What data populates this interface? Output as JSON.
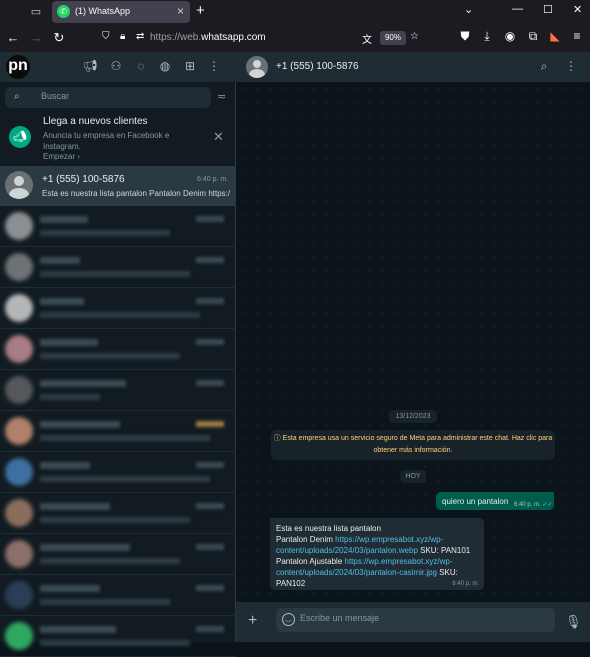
{
  "browser": {
    "tab_title": "(1) WhatsApp",
    "url_host": "https://web.",
    "url_domain": "whatsapp.com",
    "zoom": "90%"
  },
  "sidebar": {
    "logo": "pn",
    "search_placeholder": "Buscar",
    "promo": {
      "title": "Llega a nuevos clientes",
      "text": "Anuncia tu empresa en Facebook e Instagram.",
      "link": "Empezar ›"
    },
    "active_chat": {
      "name": "+1 (555) 100-5876",
      "time": "6:40 p. m.",
      "preview": "Esta es nuestra lista pantalon     Pantalon Denim https://wp.empresabot.xyz"
    }
  },
  "conversation": {
    "contact": "+1 (555) 100-5876",
    "date_chip": "13/12/2023",
    "encryption_notice": "Esta empresa usa un servicio seguro de Meta para administrar este chat. Haz clic para obtener más información.",
    "today_chip": "HOY",
    "outgoing": {
      "text": "quiero un pantalon",
      "time": "6:40 p. m."
    },
    "incoming": {
      "line1": "Esta es nuestra lista pantalon",
      "item1_label": "Pantalon Denim ",
      "item1_url": "https://wp.empresabot.xyz/wp-content/uploads/2024/03/pantalon.webp",
      "item1_sku": " SKU: PAN101",
      "item2_label": "Pantalon Ajustable ",
      "item2_url": "https://wp.empresabot.xyz/wp-content/uploads/2024/03/pantalon-casimir.jpg",
      "item2_sku": " SKU: PAN102",
      "time": "6:40 p. m."
    },
    "composer_placeholder": "Escribe un mensaje"
  },
  "colors": {
    "accent": "#00a884",
    "outgoing_bubble": "#005c4b",
    "link": "#53bdeb"
  }
}
